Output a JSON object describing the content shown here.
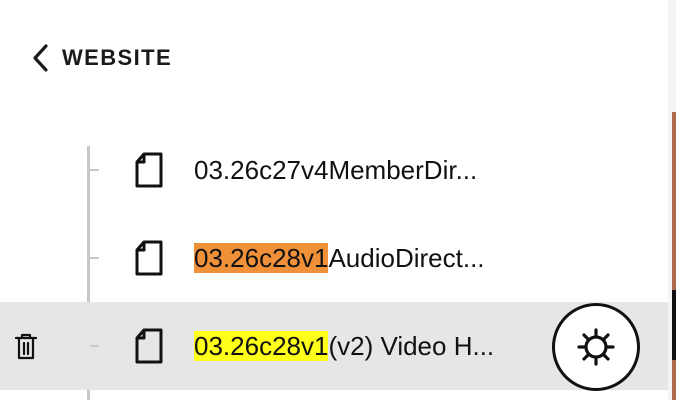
{
  "header": {
    "back_label": "WEBSITE",
    "back_icon": "chevron-left-icon"
  },
  "pages": [
    {
      "highlight": "",
      "highlight_color": "",
      "rest": "03.26c27v4MemberDir...",
      "icon": "page-icon",
      "selected": false
    },
    {
      "highlight": "03.26c28v1",
      "highlight_color": "#f0913a",
      "rest": "AudioDirect...",
      "icon": "page-icon",
      "selected": false
    },
    {
      "highlight": "03.26c28v1",
      "highlight_color": "#ffff1a",
      "rest": "(v2) Video H...",
      "icon": "page-icon",
      "selected": true,
      "actions": [
        "trash-icon",
        "gear-icon"
      ]
    }
  ],
  "colors": {
    "selected_row": "#e6e6e6",
    "tree_line": "#c8c8c8",
    "text": "#111111"
  }
}
